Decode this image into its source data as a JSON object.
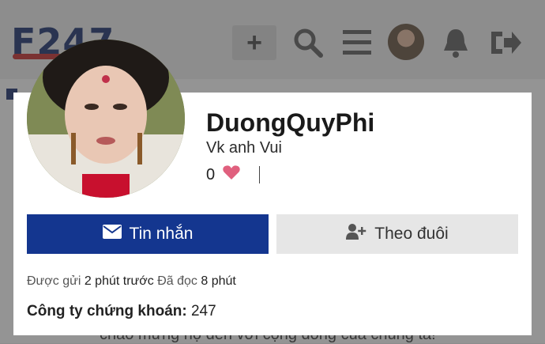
{
  "background": {
    "logo": "F247",
    "plus": "+",
    "welcome": "chào mừng họ đến với cộng đồng của chúng ta!"
  },
  "profile": {
    "username": "DuongQuyPhi",
    "user_title": "Vk anh Vui",
    "reaction_count": "0"
  },
  "actions": {
    "message_label": "Tin nhắn",
    "follow_label": "Theo đuôi"
  },
  "meta": {
    "posted_label": "Được gửi",
    "posted_value": "2 phút trước",
    "read_label": "Đã đọc",
    "read_value": "8 phút"
  },
  "field": {
    "label": "Công ty chứng khoán:",
    "value": "247"
  },
  "colors": {
    "primary": "#14368f",
    "heart": "#e0607e"
  }
}
